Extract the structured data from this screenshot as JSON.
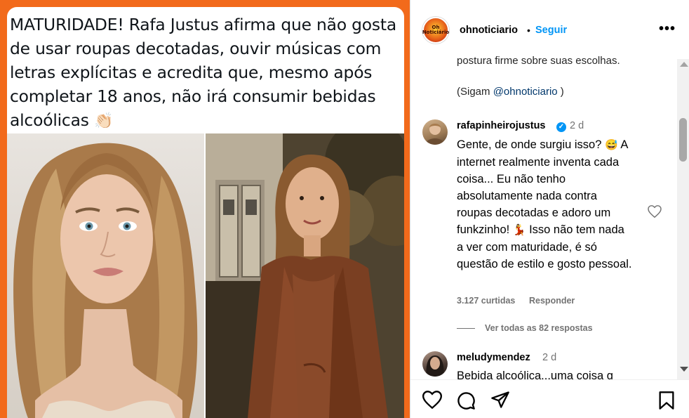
{
  "post": {
    "headline": "MATURIDADE! Rafa Justus afirma que não gosta de usar roupas decotadas, ouvir músicas com letras explícitas e acredita que, mesmo após completar 18 anos, não irá consumir bebidas alcoólicas",
    "headline_emoji": "👏🏻",
    "border_color": "#f26a1b"
  },
  "header": {
    "avatar_text": "Oh Noticiário",
    "username": "ohnoticiario",
    "separator": "•",
    "follow_label": "Seguir",
    "more_label": "•••"
  },
  "caption": {
    "tail": "postura firme sobre suas escolhas.",
    "follow_prefix": "(Sigam ",
    "mention": "@ohnoticiario",
    "follow_suffix": " )"
  },
  "comments": [
    {
      "username": "rafapinheirojustus",
      "verified": true,
      "time": "2 d",
      "text_1": "Gente, de onde surgiu isso?",
      "emoji_1": "😅",
      "text_2": " A internet realmente inventa cada coisa... Eu não tenho absolutamente nada contra roupas decotadas e adoro um funkzinho! ",
      "emoji_2": "💃",
      "text_3": " Isso não tem nada a ver com maturidade, é só questão de estilo e gosto pessoal.",
      "likes": "3.127 curtidas",
      "reply_label": "Responder",
      "view_replies": "Ver todas as 82 respostas"
    },
    {
      "username": "meludymendez",
      "verified": false,
      "time": "2 d",
      "text": "Bebida alcoólica...uma coisa g"
    }
  ],
  "colors": {
    "link": "#0095f6",
    "muted": "#737373"
  },
  "icons": [
    "heart-icon",
    "comment-icon",
    "share-icon",
    "bookmark-icon",
    "more-icon",
    "verified-icon"
  ]
}
